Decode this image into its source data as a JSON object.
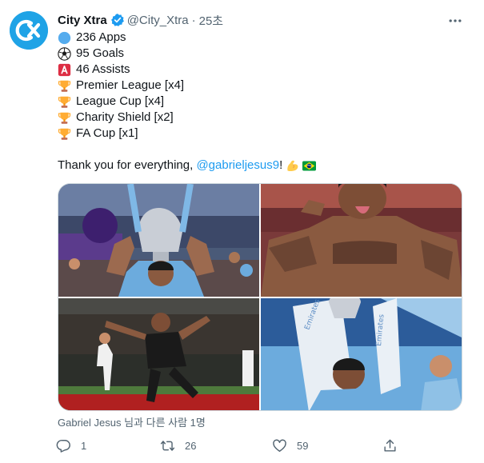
{
  "tweet": {
    "author_name": "City Xtra",
    "author_handle": "@City_Xtra",
    "separator": "·",
    "time": "25초",
    "stats": [
      {
        "icon": "blue-circle-icon",
        "text": "236 Apps"
      },
      {
        "icon": "soccer-ball-icon",
        "text": "95 Goals"
      },
      {
        "icon": "a-button-icon",
        "text": "46 Assists"
      },
      {
        "icon": "trophy-icon",
        "text": "Premier League [x4]"
      },
      {
        "icon": "trophy-icon",
        "text": "League Cup [x4]"
      },
      {
        "icon": "trophy-icon",
        "text": "Charity Shield [x2]"
      },
      {
        "icon": "trophy-icon",
        "text": "FA Cup [x1]"
      }
    ],
    "thanks_prefix": "Thank you for everything, ",
    "mention": "@gabrieljesus9",
    "thanks_suffix": "!",
    "media_tag_text": "Gabriel Jesus 님과 다른 사람 1명",
    "reply_count": "1",
    "retweet_count": "26",
    "like_count": "59"
  },
  "colors": {
    "accent": "#1d9bf0",
    "avatar_bg": "#1fa3e6",
    "muted_text": "#536471",
    "city_sky_blue": "#6cabdd"
  }
}
